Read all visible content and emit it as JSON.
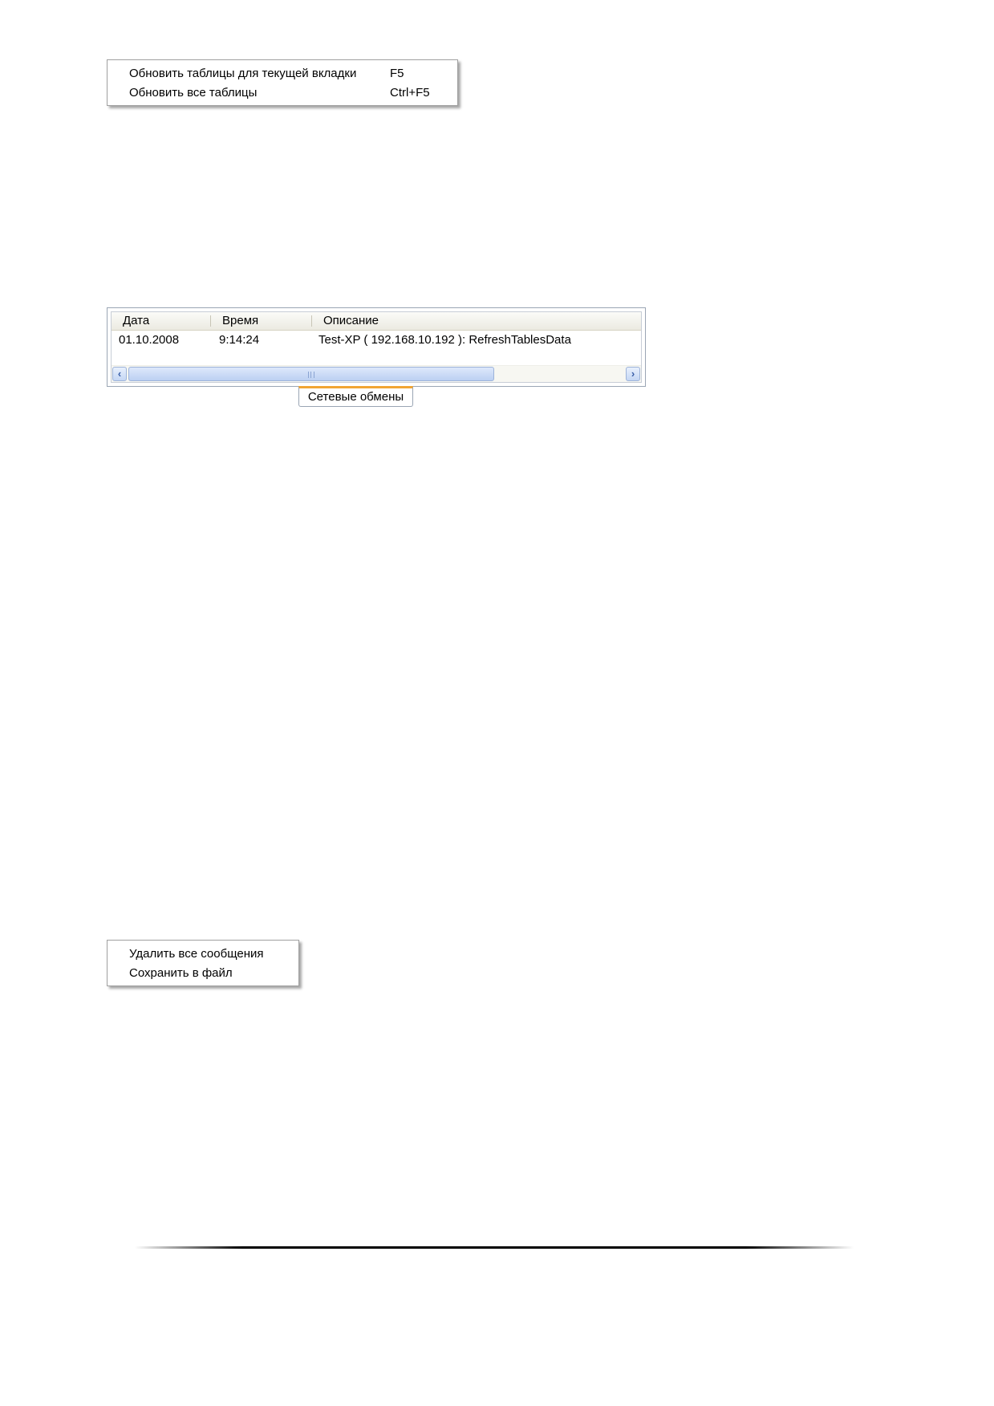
{
  "refresh_menu": {
    "items": [
      {
        "label": "Обновить таблицы для текущей вкладки",
        "shortcut": "F5"
      },
      {
        "label": "Обновить все таблицы",
        "shortcut": "Ctrl+F5"
      }
    ]
  },
  "log_panel": {
    "columns": [
      "Дата",
      "Время",
      "Описание"
    ],
    "rows": [
      {
        "date": "01.10.2008",
        "time": "9:14:24",
        "description": "Test-XP ( 192.168.10.192 ): RefreshTablesData"
      }
    ],
    "tab_label": "Сетевые обмены"
  },
  "messages_menu": {
    "items": [
      {
        "label": "Удалить все сообщения"
      },
      {
        "label": "Сохранить в файл"
      }
    ]
  },
  "icons": {
    "scroll_left": "chevron-left-icon",
    "scroll_right": "chevron-right-icon"
  },
  "colors": {
    "tab_accent": "#f1a534",
    "scrollbar": "#c4d6f4"
  }
}
